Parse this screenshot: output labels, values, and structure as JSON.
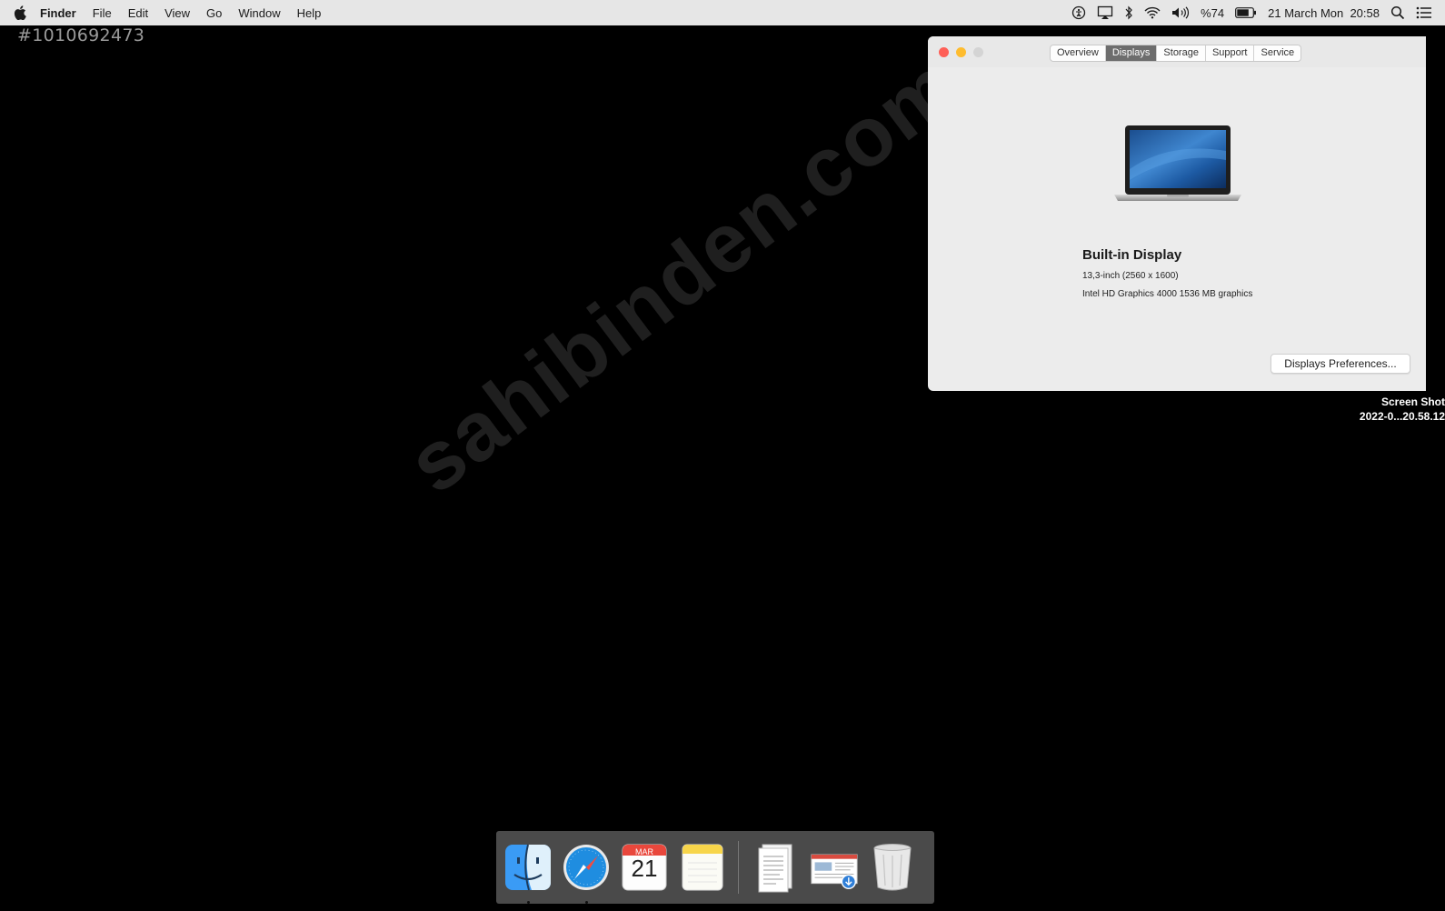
{
  "menubar": {
    "app_name": "Finder",
    "items": [
      "File",
      "Edit",
      "View",
      "Go",
      "Window",
      "Help"
    ],
    "battery": "%74",
    "clock": "21 March Mon  20:58"
  },
  "desktop": {
    "listing_id": "#1010692473",
    "watermark": "sahibinden.com",
    "file_line1": "Screen Shot",
    "file_line2": "2022-0...20.58.12"
  },
  "about_window": {
    "tabs": [
      "Overview",
      "Displays",
      "Storage",
      "Support",
      "Service"
    ],
    "active_tab": "Displays",
    "display_title": "Built-in Display",
    "display_resolution": "13,3-inch (2560 x 1600)",
    "display_graphics": "Intel HD Graphics 4000 1536 MB graphics",
    "prefs_button": "Displays Preferences..."
  },
  "dock": {
    "calendar_month": "MAR",
    "calendar_day": "21",
    "items": [
      "finder-icon",
      "safari-icon",
      "calendar-icon",
      "notes-icon",
      "documents-icon",
      "downloads-icon",
      "trash-icon"
    ]
  },
  "colors": {
    "close": "#fe5f57",
    "minimize": "#febc2e",
    "active_tab": "#6d6d6d",
    "menubar": "#e6e6e6"
  }
}
